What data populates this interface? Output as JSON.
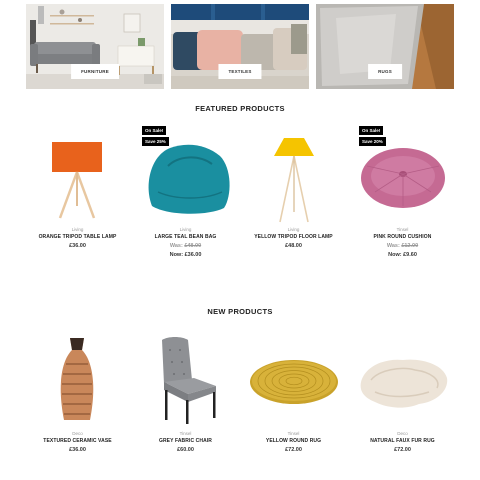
{
  "categories": [
    {
      "label": "FURNITURE"
    },
    {
      "label": "TEXTILES"
    },
    {
      "label": "RUGS"
    }
  ],
  "featured": {
    "title": "FEATURED PRODUCTS",
    "products": [
      {
        "category": "Living",
        "name": "ORANGE TRIPOD TABLE LAMP",
        "price": "£36.00"
      },
      {
        "category": "Living",
        "name": "LARGE TEAL BEAN BAG",
        "badge1": "On Sale!",
        "badge2": "Save 25%",
        "was_label": "Was:",
        "was": "£48.00",
        "now_label": "Now:",
        "now": "£36.00"
      },
      {
        "category": "Living",
        "name": "YELLOW TRIPOD FLOOR LAMP",
        "price": "£48.00"
      },
      {
        "category": "Tinsel",
        "name": "PINK ROUND CUSHION",
        "badge1": "On Sale!",
        "badge2": "Save 20%",
        "was_label": "Was:",
        "was": "£12.00",
        "now_label": "Now:",
        "now": "£9.60"
      }
    ]
  },
  "new": {
    "title": "NEW PRODUCTS",
    "products": [
      {
        "category": "Deco",
        "name": "TEXTURED CERAMIC VASE",
        "price": "£36.00"
      },
      {
        "category": "Tinsel",
        "name": "GREY FABRIC CHAIR",
        "price": "£60.00"
      },
      {
        "category": "Tinsel",
        "name": "YELLOW ROUND RUG",
        "price": "£72.00"
      },
      {
        "category": "Deco",
        "name": "NATURAL FAUX FUR RUG",
        "price": "£72.00"
      }
    ]
  },
  "colors": {
    "badge": "#000000",
    "accent_orange": "#e8621c",
    "accent_teal": "#1a8fa0",
    "accent_yellow": "#f5c400",
    "accent_pink": "#c56a93"
  }
}
